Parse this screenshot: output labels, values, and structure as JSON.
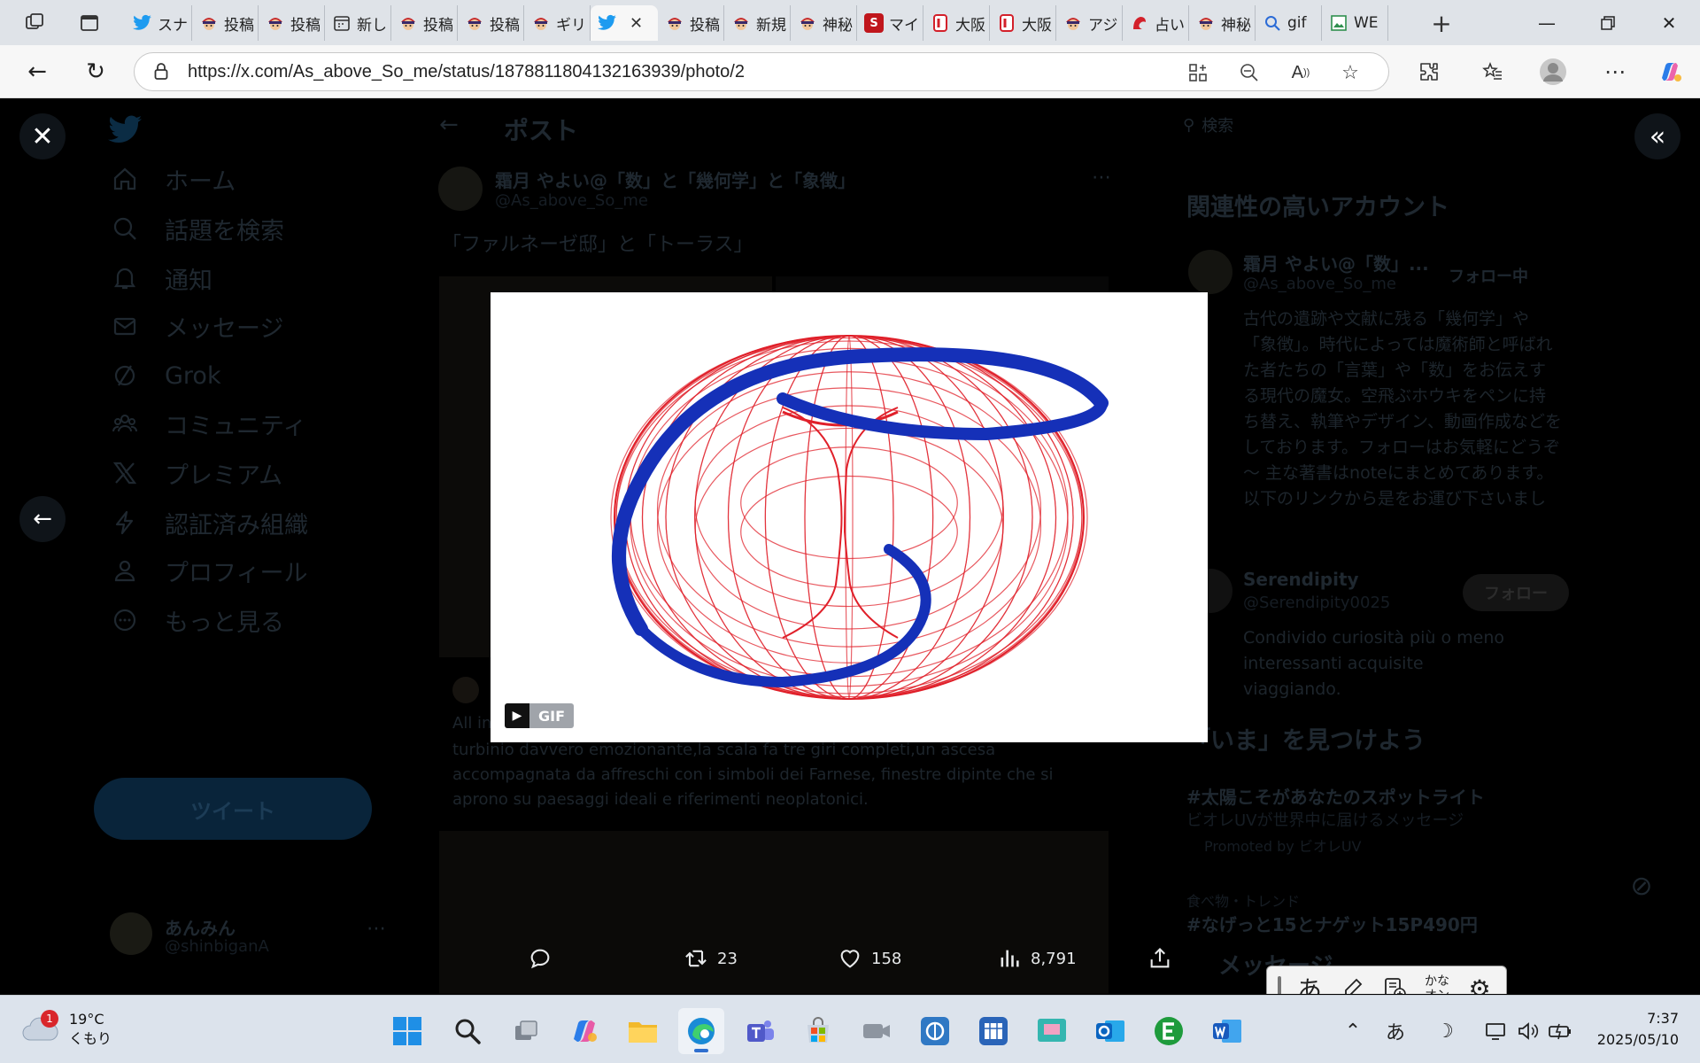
{
  "browser": {
    "tabs": [
      {
        "label": "スナ",
        "icon": "twitter-icon"
      },
      {
        "label": "投稿",
        "icon": "ninja-icon"
      },
      {
        "label": "投稿",
        "icon": "ninja-icon"
      },
      {
        "label": "新し",
        "icon": "calendar-icon"
      },
      {
        "label": "投稿",
        "icon": "ninja-icon"
      },
      {
        "label": "投稿",
        "icon": "ninja-icon"
      },
      {
        "label": "ギリ",
        "icon": "ninja-icon"
      },
      {
        "label": "",
        "icon": "twitter-icon",
        "active": true
      },
      {
        "label": "投稿",
        "icon": "ninja-icon"
      },
      {
        "label": "新規",
        "icon": "ninja-icon"
      },
      {
        "label": "神秘",
        "icon": "ninja-icon"
      },
      {
        "label": "マイ",
        "icon": "red-s-icon"
      },
      {
        "label": "大阪",
        "icon": "red-d-icon"
      },
      {
        "label": "大阪",
        "icon": "red-d-icon"
      },
      {
        "label": "アジ",
        "icon": "ninja-icon"
      },
      {
        "label": "占い",
        "icon": "red-shape-icon"
      },
      {
        "label": "神秘",
        "icon": "ninja-icon"
      },
      {
        "label": "gif",
        "icon": "search-icon"
      },
      {
        "label": "WE",
        "icon": "green-image-icon"
      }
    ],
    "url": "https://x.com/As_above_So_me/status/1878811804132163939/photo/2"
  },
  "page": {
    "nav": [
      {
        "label": "ホーム",
        "icon": "home-icon"
      },
      {
        "label": "話題を検索",
        "icon": "search-icon"
      },
      {
        "label": "通知",
        "icon": "bell-icon"
      },
      {
        "label": "メッセージ",
        "icon": "mail-icon"
      },
      {
        "label": "Grok",
        "icon": "grok-icon"
      },
      {
        "label": "コミュニティ",
        "icon": "community-icon"
      },
      {
        "label": "プレミアム",
        "icon": "x-logo-icon"
      },
      {
        "label": "認証済み組織",
        "icon": "lightning-icon"
      },
      {
        "label": "プロフィール",
        "icon": "person-icon"
      },
      {
        "label": "もっと見る",
        "icon": "more-circle-icon"
      }
    ],
    "tweet_button": "ツイート",
    "me_name": "あんみん",
    "me_handle": "@shinbiganA",
    "header_title": "ポスト",
    "author_name": "霜月 やよい@「数」と「幾何学」と「象徴」",
    "author_handle": "@As_above_So_me",
    "post_text": "「ファルネーゼ邸」と「トーラス」",
    "quoted_text_1": "All in",
    "quoted_text_2": "turbinio davvero emozionante,la scala fa tre giri completi,un ascesa",
    "quoted_text_3": "accompagnata da affreschi con i simboli dei Farnese, finestre dipinte che si",
    "quoted_text_4": "aprono su paesaggi ideali e riferimenti neoplatonici.",
    "search_placeholder": "検索",
    "related_title": "関連性の高いアカウント",
    "rel1_name": "霜月 やよい@「数」...",
    "rel1_handle": "@As_above_So_me",
    "rel1_btn": "フォロー中",
    "rel1_bio": "古代の遺跡や文献に残る「幾何学」や「象徴」。時代によっては魔術師と呼ばれた者たちの「言葉」や「数」をお伝えする現代の魔女。空飛ぶホウキをペンに持ち替え、執筆やデザイン、動画作成などをしております。フォローはお気軽にどうぞ～ 主な著書はnoteにまとめてあります。以下のリンクから是をお運び下さいまし",
    "rel2_name": "Serendipity",
    "rel2_handle": "@Serendipity0025",
    "rel2_btn": "フォロー",
    "rel2_bio": "Condivido curiosità più o meno interessanti acquisite viaggiando.",
    "trend_title": "「いま」を見つけよう",
    "trend1": "#太陽こそがあなたのスポットライト",
    "trend1_sub": "ビオレUVが世界中に届けるメッセージ",
    "trend1_promo": "Promoted by ビオレUV",
    "trend2_sub": "食べ物・トレンド",
    "trend2": "#なげっと15とナゲット15P490円",
    "messages_title": "メッセージ"
  },
  "media": {
    "badge": "GIF"
  },
  "actions": {
    "reply": "",
    "retweet": "23",
    "like": "158",
    "views": "8,791"
  },
  "ime": {
    "hiragana": "あ",
    "kana_top": "かな",
    "kana_bottom": "オン"
  },
  "taskbar": {
    "weather_temp": "19°C",
    "weather_desc": "くもり",
    "weather_badge": "1",
    "ime_indicator": "あ",
    "time": "7:37",
    "date": "2025/05/10"
  },
  "colors": {
    "torus_grid": "#e0202a",
    "ribbon": "#1530b8"
  }
}
